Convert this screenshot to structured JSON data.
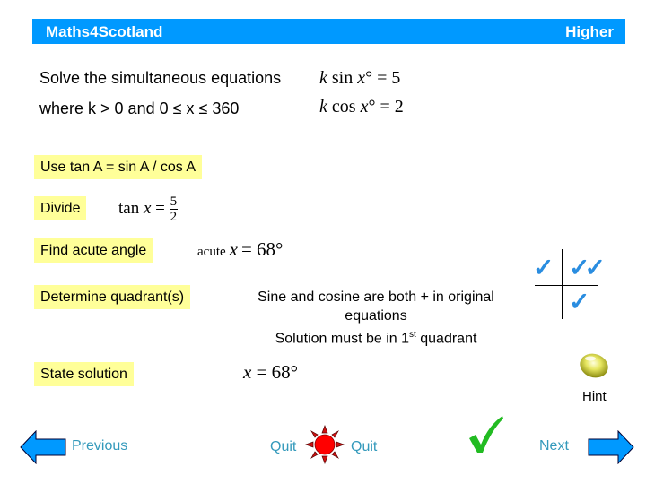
{
  "header": {
    "title": "Maths4Scotland",
    "level": "Higher",
    "background_color": "#0099ff"
  },
  "question": {
    "line1": "Solve the simultaneous equations",
    "line2": "where  k > 0  and   0 ≤  x  ≤  360",
    "equation1": {
      "lhs_k": "k",
      "fn": "sin",
      "var": "x",
      "deg": "°",
      "rhs": "= 5"
    },
    "equation2": {
      "lhs_k": "k",
      "fn": "cos",
      "var": "x",
      "deg": "°",
      "rhs": "= 2"
    }
  },
  "steps": [
    {
      "label": "Use tan A = sin A / cos A"
    },
    {
      "label": "Divide",
      "work": {
        "fn": "tan",
        "var": "x",
        "eq": "=",
        "numerator": "5",
        "denominator": "2"
      }
    },
    {
      "label": "Find acute angle",
      "work": {
        "prefix": "acute",
        "var": "x",
        "eq": "= 68°"
      }
    },
    {
      "label": "Determine quadrant(s)",
      "work": {
        "line1": "Sine and cosine are both + in original",
        "line2": "equations",
        "line3_pre": "Solution must be in 1",
        "line3_sup": "st",
        "line3_post": " quadrant"
      }
    },
    {
      "label": "State solution",
      "work": {
        "var": "x",
        "eq": "= 68°"
      }
    }
  ],
  "step_box_color": "#ffff99",
  "quadrant_diagram": {
    "marks": {
      "first": "✓✓",
      "second": "✓",
      "third": "",
      "fourth": "✓"
    },
    "tick_color": "#2a8de0"
  },
  "hint": {
    "label": "Hint",
    "icon": "hint-bulb-icon"
  },
  "nav": {
    "previous_label": "Previous",
    "quit_left_label": "Quit",
    "quit_right_label": "Quit",
    "next_label": "Next",
    "link_color": "#3399bb",
    "arrow_color": "#0099ff",
    "quit_icon_color": "#ff0000",
    "check_color": "#22bb22"
  }
}
